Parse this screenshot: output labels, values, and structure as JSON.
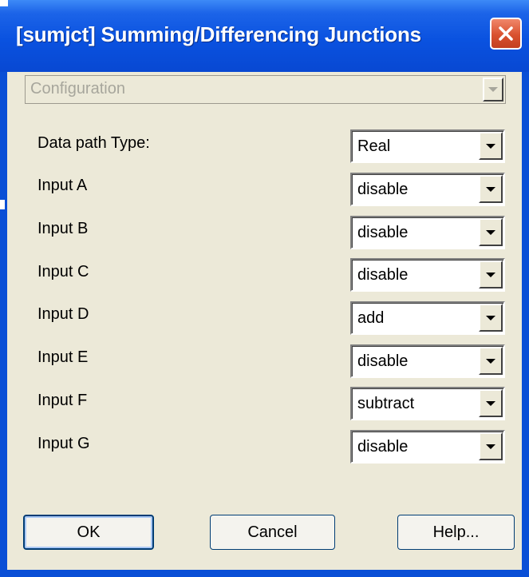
{
  "window": {
    "title": "[sumjct] Summing/Differencing Junctions",
    "close_icon": "close-icon"
  },
  "section": {
    "selected": "Configuration",
    "enabled": false
  },
  "fields": [
    {
      "label": "Data path Type:",
      "value": "Real"
    },
    {
      "label": "Input A",
      "value": "disable"
    },
    {
      "label": "Input B",
      "value": "disable"
    },
    {
      "label": "Input C",
      "value": "disable"
    },
    {
      "label": "Input D",
      "value": "add"
    },
    {
      "label": "Input E",
      "value": "disable"
    },
    {
      "label": "Input F",
      "value": "subtract"
    },
    {
      "label": "Input G",
      "value": "disable"
    }
  ],
  "buttons": {
    "ok": "OK",
    "cancel": "Cancel",
    "help": "Help..."
  },
  "colors": {
    "titlebar": "#0a52e0",
    "client_bg": "#ece9d8",
    "close_button": "#d9512f",
    "button_border": "#003c74"
  }
}
